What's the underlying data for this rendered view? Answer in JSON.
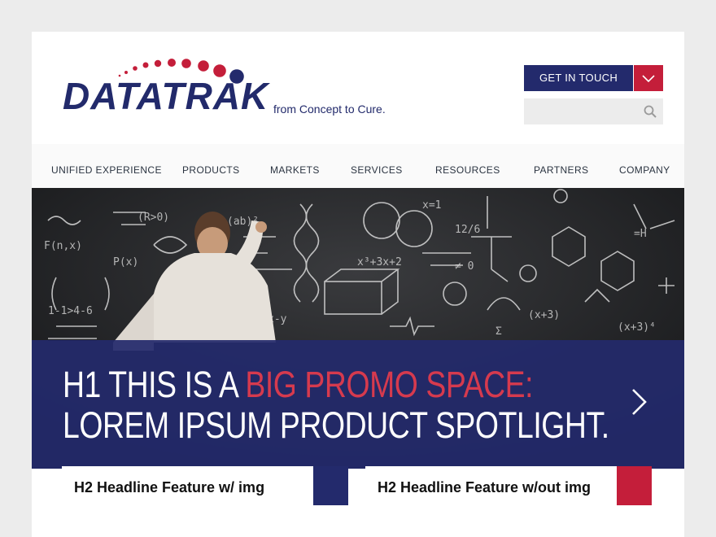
{
  "brand": {
    "logo_word": "DATATRAK",
    "tagline": "from Concept to Cure."
  },
  "header": {
    "cta_label": "GET IN TOUCH",
    "cta_dropdown_icon": "chevron-down-icon",
    "search_placeholder": "",
    "search_icon": "search-icon"
  },
  "nav": {
    "items": [
      {
        "label": "UNIFIED EXPERIENCE"
      },
      {
        "label": "PRODUCTS"
      },
      {
        "label": "MARKETS"
      },
      {
        "label": "SERVICES"
      },
      {
        "label": "RESOURCES"
      },
      {
        "label": "PARTNERS"
      },
      {
        "label": "COMPANY"
      }
    ]
  },
  "hero": {
    "line1_prefix": "H1 THIS IS A ",
    "line1_highlight": "BIG PROMO SPACE:",
    "line2": "LOREM IPSUM PRODUCT SPOTLIGHT.",
    "next_icon": "chevron-right-icon"
  },
  "features": [
    {
      "title": "H2 Headline Feature w/ img",
      "accent": "#232a6c"
    },
    {
      "title": "H2 Headline Feature w/out img",
      "accent": "#c41e3a"
    }
  ],
  "colors": {
    "brand_navy": "#232a6c",
    "brand_red": "#c41e3a",
    "page_bg": "#ececec"
  }
}
